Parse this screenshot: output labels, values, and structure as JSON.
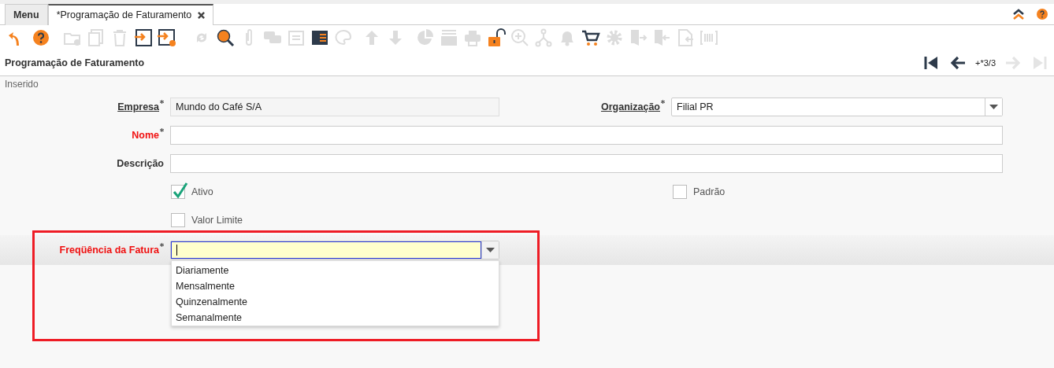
{
  "tabs": [
    {
      "label": "Menu",
      "selected": false,
      "closable": false
    },
    {
      "label": "*Programação de Faturamento",
      "selected": true,
      "closable": true
    }
  ],
  "toolbar": [
    {
      "disabled": false
    },
    {
      "disabled": false
    },
    {
      "disabled": true
    },
    {
      "disabled": true
    },
    {
      "disabled": true
    },
    {
      "disabled": false
    },
    {
      "disabled": false
    },
    {
      "disabled": true
    },
    {
      "disabled": false
    },
    {
      "disabled": true
    },
    {
      "disabled": true
    },
    {
      "disabled": true
    },
    {
      "disabled": false
    },
    {
      "disabled": true
    },
    {
      "disabled": true
    },
    {
      "disabled": true
    },
    {
      "disabled": true
    },
    {
      "disabled": true
    },
    {
      "disabled": true
    },
    {
      "disabled": false
    },
    {
      "disabled": true
    },
    {
      "disabled": true
    },
    {
      "disabled": true
    },
    {
      "disabled": false
    },
    {
      "disabled": true
    },
    {
      "disabled": true
    },
    {
      "disabled": true
    },
    {
      "disabled": true
    },
    {
      "disabled": true
    }
  ],
  "title": "Programação de Faturamento",
  "record_nav": {
    "position": "+*3/3",
    "buttons": [
      {
        "disabled": false
      },
      {
        "disabled": false
      },
      {
        "disabled": true
      },
      {
        "disabled": true
      }
    ]
  },
  "status": "Inserido",
  "rows": [
    [
      {
        "kind": "text",
        "label": "Empresa",
        "required": true,
        "link": true,
        "missing": false,
        "readonly": true,
        "value": "Mundo do Café S/A"
      },
      {
        "kind": "select",
        "label": "Organização",
        "required": true,
        "link": true,
        "missing": false,
        "value": "Filial PR"
      }
    ],
    [
      {
        "kind": "text",
        "label": "Nome",
        "required": true,
        "link": false,
        "missing": true,
        "readonly": false,
        "wide": true
      }
    ],
    [
      {
        "kind": "text",
        "label": "Descrição",
        "required": false,
        "link": false,
        "missing": false,
        "readonly": false,
        "wide": true
      }
    ],
    [
      {
        "kind": "checkbox",
        "label": "Ativo",
        "checked": true
      },
      {
        "kind": "checkbox",
        "label": "Padrão",
        "checked": false
      }
    ],
    [
      {
        "kind": "checkbox",
        "label": "Valor Limite",
        "checked": false
      }
    ],
    [
      {
        "kind": "combo",
        "label": "Freqüência da Fatura",
        "required": true,
        "link": false,
        "missing": true,
        "focused": true,
        "expanded": true,
        "options": [
          "Diariamente",
          "Mensalmente",
          "Quinzenalmente",
          "Semanalmente"
        ]
      }
    ]
  ]
}
